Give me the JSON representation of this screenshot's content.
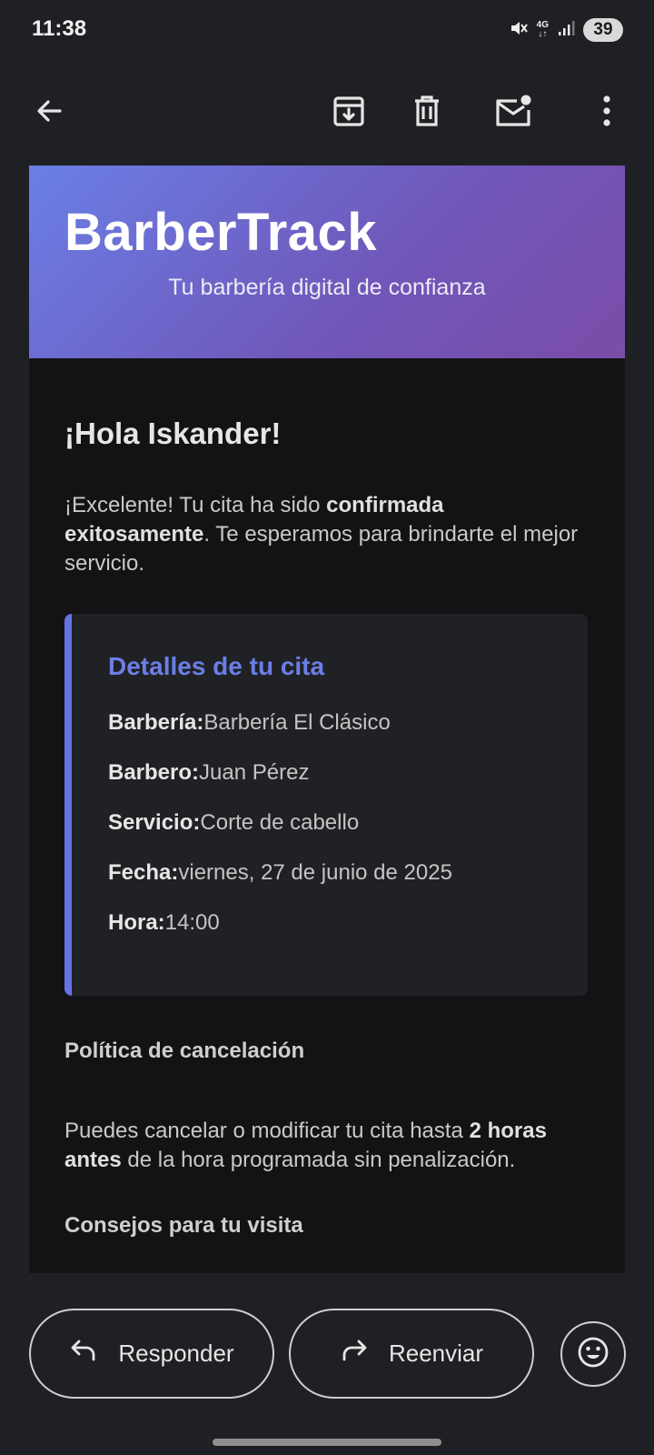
{
  "status_bar": {
    "time": "11:38",
    "network": "4G",
    "battery": "39"
  },
  "toolbar": {
    "back_icon": "arrow-left-icon",
    "archive_icon": "archive-icon",
    "delete_icon": "trash-icon",
    "unread_icon": "mark-unread-icon",
    "more_icon": "more-vert-icon"
  },
  "email": {
    "brand": "BarberTrack",
    "tagline": "Tu barbería digital de confianza",
    "greeting": "¡Hola Iskander!",
    "intro": {
      "part1": "¡Excelente! Tu cita ha sido ",
      "bold": "confirmada exitosamente",
      "part2": ". Te esperamos para brindarte el mejor servicio."
    },
    "details": {
      "title": "Detalles de tu cita",
      "rows": [
        {
          "label": "Barbería:",
          "value": "Barbería El Clásico"
        },
        {
          "label": "Barbero:",
          "value": "Juan Pérez"
        },
        {
          "label": "Servicio:",
          "value": "Corte de cabello"
        },
        {
          "label": "Fecha:",
          "value": "viernes, 27 de junio de 2025"
        },
        {
          "label": "Hora:",
          "value": "14:00"
        }
      ]
    },
    "policy_title": "Política de cancelación",
    "policy": {
      "part1": "Puedes cancelar o modificar tu cita hasta ",
      "bold": "2 horas antes",
      "part2": " de la hora programada sin penalización."
    },
    "tips_title": "Consejos para tu visita"
  },
  "actions": {
    "reply_label": "Responder",
    "forward_label": "Reenviar",
    "emoji_icon": "smiley-icon"
  },
  "colors": {
    "background": "#1f2023",
    "email_background": "#131316",
    "accent": "#6474e5",
    "hero_gradient_start": "#6a7fe6",
    "hero_gradient_end": "#7a4da8"
  }
}
